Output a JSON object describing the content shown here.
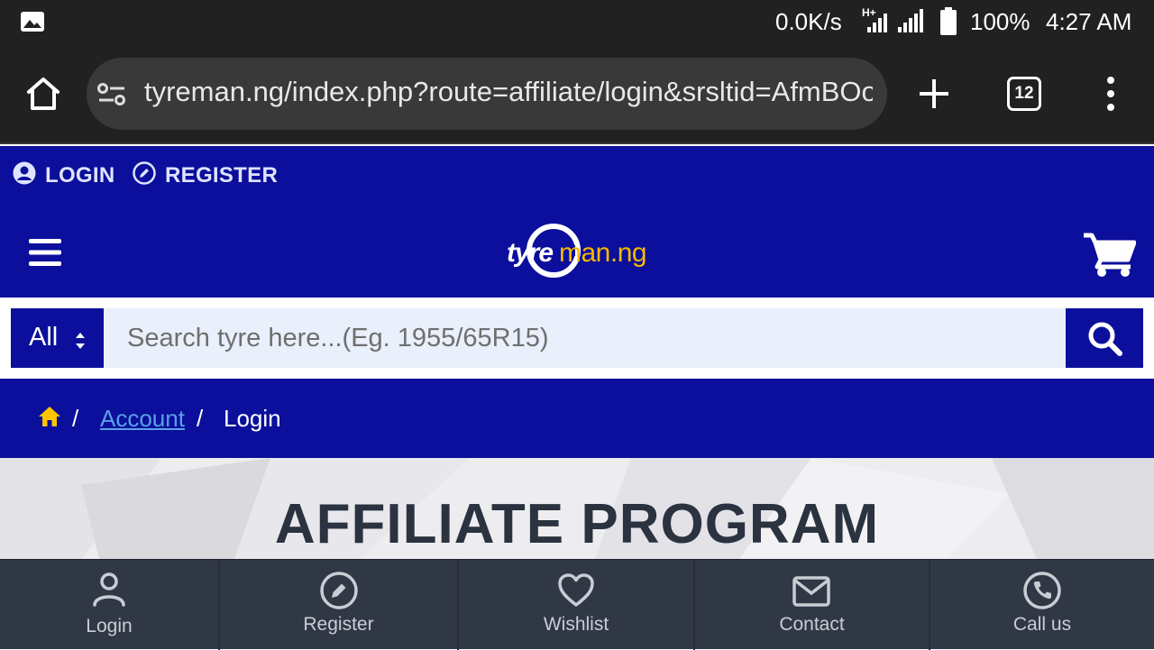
{
  "status_bar": {
    "speed": "0.0K/s",
    "network": "H+",
    "battery": "100%",
    "time": "4:27 AM"
  },
  "browser": {
    "url": "tyreman.ng/index.php?route=affiliate/login&srsltid=AfmBOoq",
    "tab_count": "12"
  },
  "top_links": {
    "login": "LOGIN",
    "register": "REGISTER"
  },
  "logo": {
    "part1": "tyre",
    "part2": "man.ng"
  },
  "search": {
    "category": "All",
    "placeholder": "Search tyre here...(Eg. 1955/65R15)"
  },
  "breadcrumb": {
    "sep": "/",
    "account": "Account",
    "current": "Login"
  },
  "hero": {
    "title": "AFFILIATE PROGRAM"
  },
  "bottom_nav": {
    "items": [
      {
        "label": "Login"
      },
      {
        "label": "Register"
      },
      {
        "label": "Wishlist"
      },
      {
        "label": "Contact"
      },
      {
        "label": "Call us"
      }
    ]
  },
  "colors": {
    "brand_blue": "#0b0f9b",
    "logo_yellow": "#f5b800",
    "nav_bg": "#303846"
  }
}
